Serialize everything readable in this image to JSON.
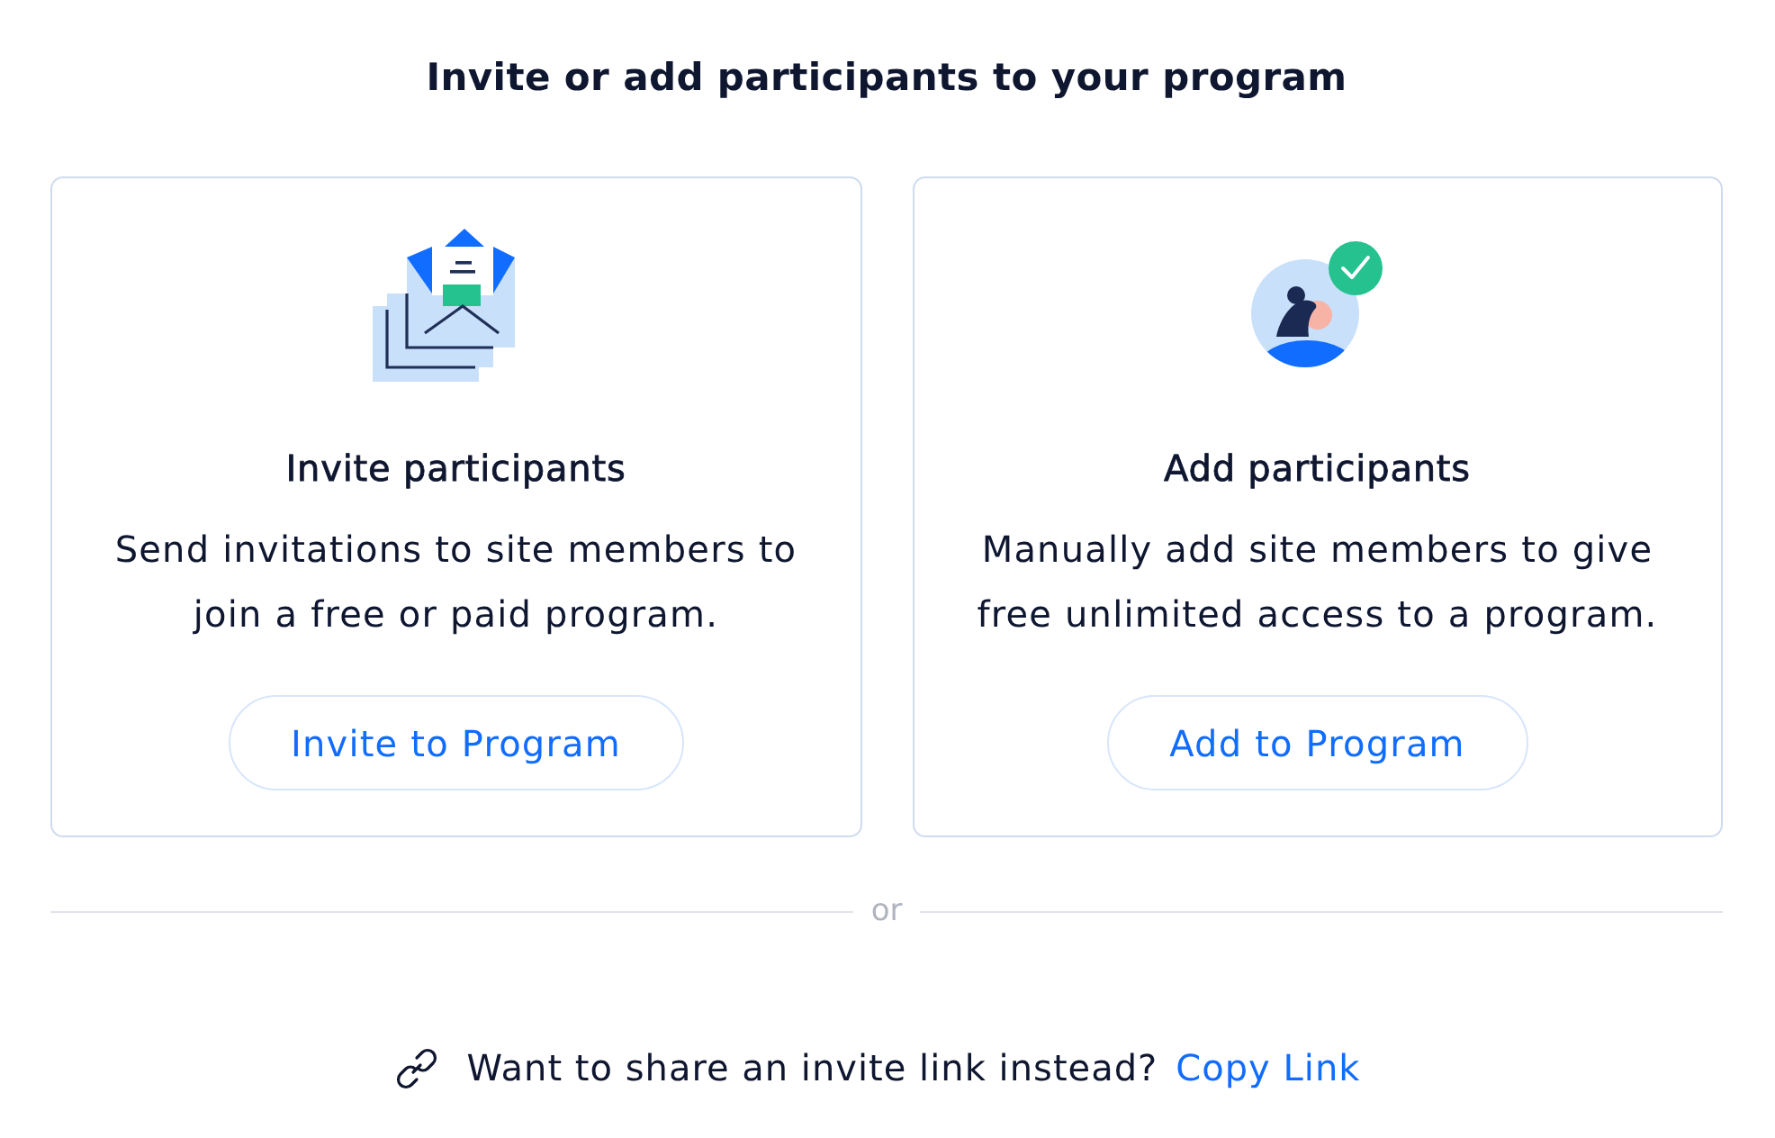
{
  "title": "Invite or add participants to your program",
  "cards": [
    {
      "kind": "invite",
      "heading": "Invite participants",
      "description": "Send invitations to site members to join a free or paid program.",
      "button": "Invite to Program"
    },
    {
      "kind": "add",
      "heading": "Add participants",
      "description": "Manually add site members to give free unlimited access to a program.",
      "button": "Add to Program"
    }
  ],
  "divider": {
    "label": "or"
  },
  "footer": {
    "question": "Want to share an invite link instead?",
    "link": "Copy Link"
  }
}
